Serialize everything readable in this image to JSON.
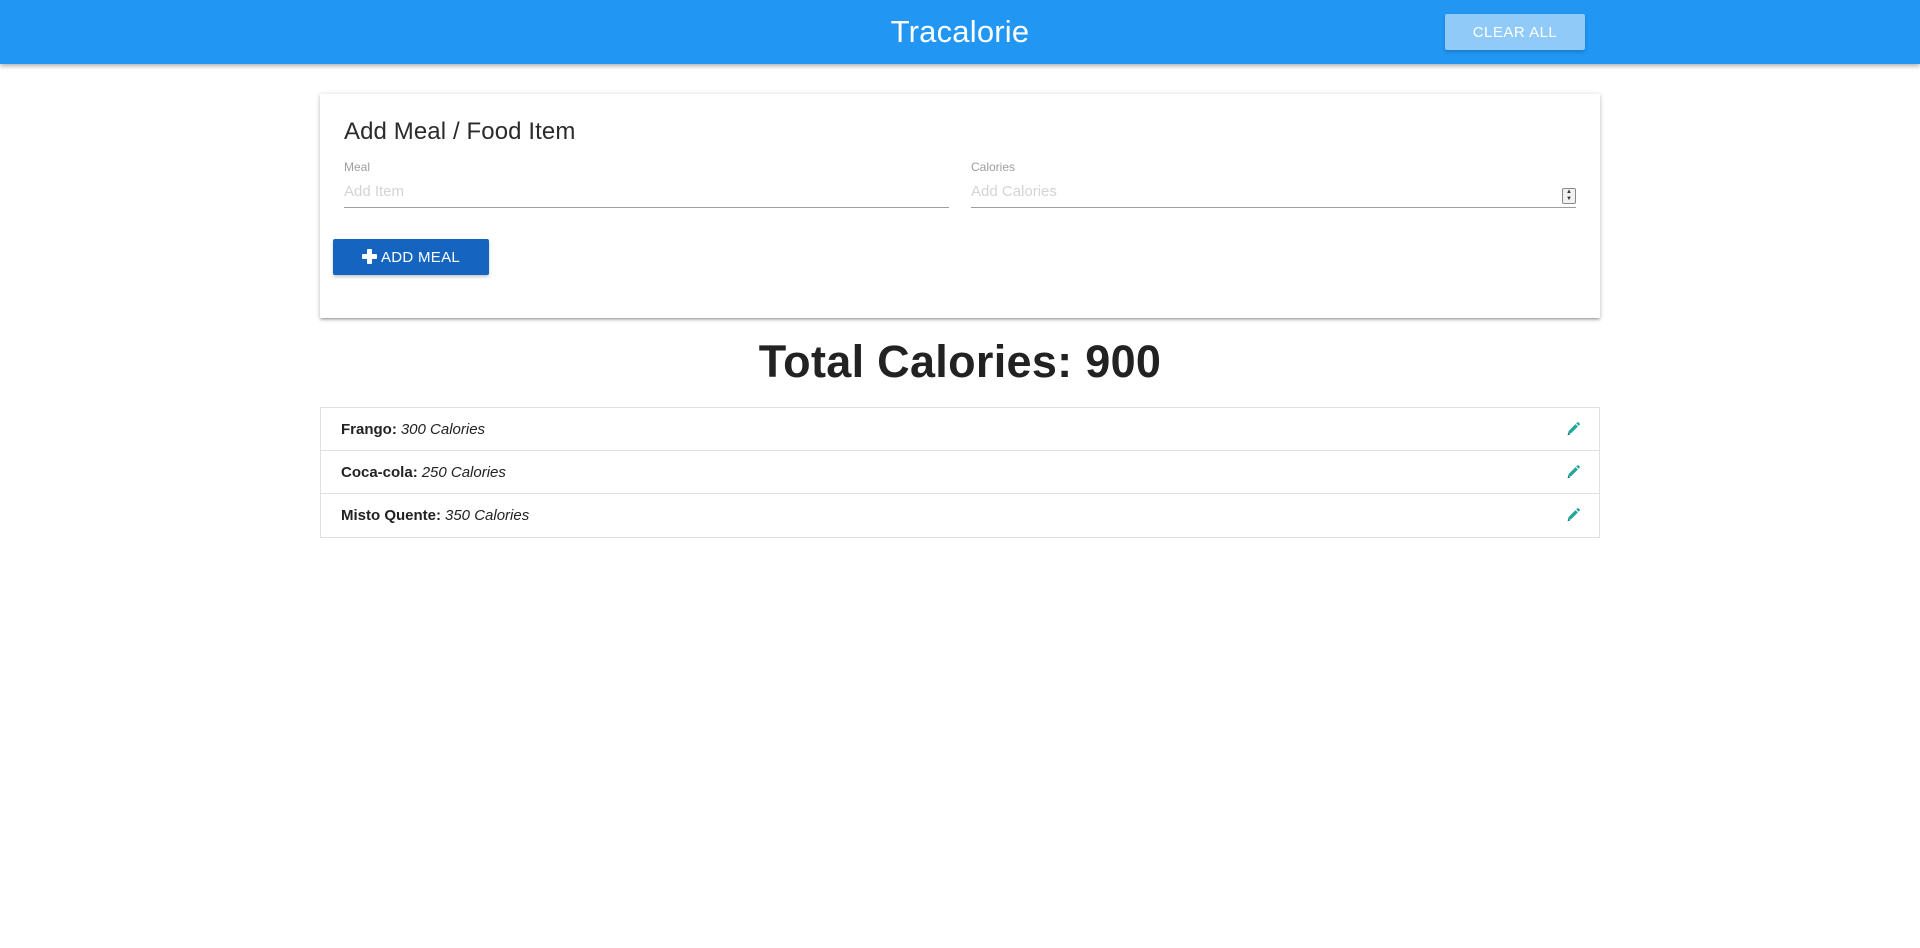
{
  "navbar": {
    "brand": "Tracalorie",
    "clear_all_label": "CLEAR ALL",
    "color": "#2196f3"
  },
  "form": {
    "title": "Add Meal / Food Item",
    "meal": {
      "label": "Meal",
      "placeholder": "Add Item",
      "value": ""
    },
    "calories": {
      "label": "Calories",
      "placeholder": "Add Calories",
      "value": ""
    },
    "add_meal_label": "ADD MEAL",
    "add_meal_icon": "plus-icon",
    "add_meal_color": "#1565c0"
  },
  "total": {
    "label": "Total Calories:",
    "value": "900"
  },
  "items": [
    {
      "name": "Frango:",
      "calories": "300 Calories",
      "icon": "pencil-icon"
    },
    {
      "name": "Coca-cola:",
      "calories": "250 Calories",
      "icon": "pencil-icon"
    },
    {
      "name": "Misto Quente:",
      "calories": "350 Calories",
      "icon": "pencil-icon"
    }
  ],
  "edit_icon_color": "#26a69a"
}
